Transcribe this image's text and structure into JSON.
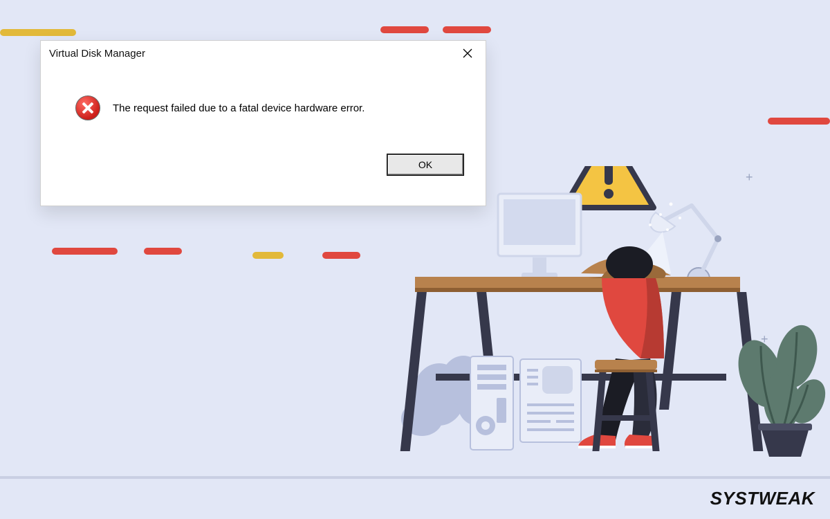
{
  "dialog": {
    "title": "Virtual Disk Manager",
    "message": "The request failed due to a fatal device hardware error.",
    "ok_label": "OK",
    "close_name": "close-icon",
    "error_icon_name": "error-x-icon"
  },
  "illustration": {
    "warning_icon_name": "warning-triangle-icon",
    "desk_name": "desk-illustration",
    "plant_name": "plant-illustration",
    "lamp_name": "desk-lamp-illustration",
    "monitor_name": "monitor-illustration",
    "person_name": "frustrated-person-illustration",
    "pc_name": "computer-tower-illustration",
    "cloud_name": "cloud-illustration"
  },
  "brand": {
    "text": "SYSTWEAK"
  },
  "colors": {
    "bg": "#e2e7f6",
    "red": "#e0483f",
    "yellow": "#e2b93a",
    "dark": "#36384b",
    "wood": "#b8824d",
    "floor": "#9aa4c0"
  }
}
